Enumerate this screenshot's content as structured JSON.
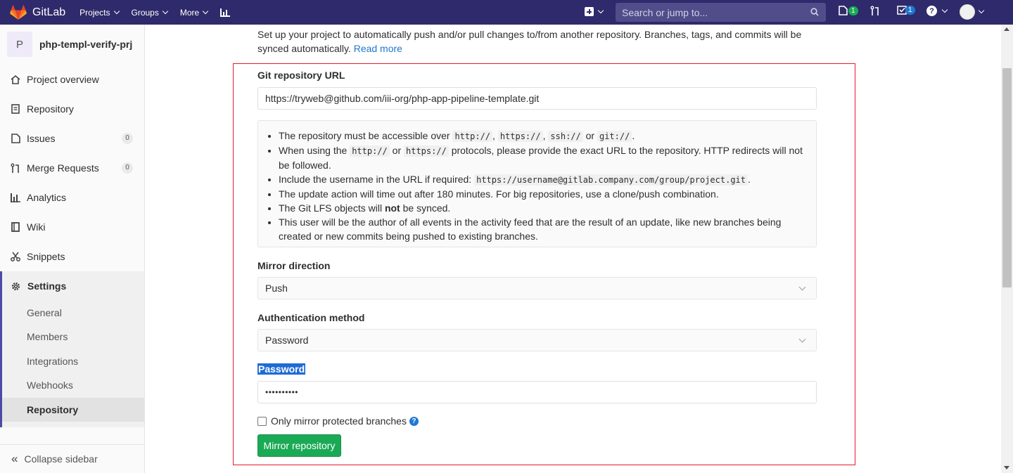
{
  "navbar": {
    "brand": "GitLab",
    "menu": [
      "Projects",
      "Groups",
      "More"
    ],
    "search_placeholder": "Search or jump to...",
    "issues_count": "1",
    "todos_count": "1"
  },
  "sidebar": {
    "project_initial": "P",
    "project_name": "php-templ-verify-prj",
    "items": [
      {
        "label": "Project overview",
        "icon": "home-icon"
      },
      {
        "label": "Repository",
        "icon": "doc-icon"
      },
      {
        "label": "Issues",
        "icon": "issues-icon",
        "count": "0"
      },
      {
        "label": "Merge Requests",
        "icon": "merge-request-icon",
        "count": "0"
      },
      {
        "label": "Analytics",
        "icon": "analytics-icon"
      },
      {
        "label": "Wiki",
        "icon": "book-icon"
      },
      {
        "label": "Snippets",
        "icon": "scissors-icon"
      }
    ],
    "settings_label": "Settings",
    "settings_sub": [
      "General",
      "Members",
      "Integrations",
      "Webhooks",
      "Repository"
    ],
    "collapse_label": "Collapse sidebar"
  },
  "main": {
    "intro_text": "Set up your project to automatically push and/or pull changes to/from another repository. Branches, tags, and commits will be synced automatically.",
    "read_more": "Read more",
    "git_url_label": "Git repository URL",
    "git_url_value": "https://tryweb@github.com/iii-org/php-app-pipeline-template.git",
    "mirror_direction_label": "Mirror direction",
    "mirror_direction_value": "Push",
    "auth_method_label": "Authentication method",
    "auth_method_value": "Password",
    "password_label": "Password",
    "password_value": "••••••••••",
    "only_protected_label": "Only mirror protected branches",
    "submit_label": "Mirror repository",
    "info": {
      "l1a": "The repository must be accessible over",
      "c_http": "http://",
      "c_https": "https://",
      "c_ssh": "ssh://",
      "or": "or",
      "c_git": "git://",
      "l2a": "When using the",
      "l2b": "protocols, please provide the exact URL to the repository. HTTP redirects will not be followed.",
      "l3a": "Include the username in the URL if required:",
      "c_example": "https://username@gitlab.company.com/group/project.git",
      "l4": "The update action will time out after 180 minutes. For big repositories, use a clone/push combination.",
      "l5a": "The Git LFS objects will",
      "l5b": "not",
      "l5c": "be synced.",
      "l6": "This user will be the author of all events in the activity feed that are the result of an update, like new branches being created or new commits being pushed to existing branches."
    }
  },
  "colors": {
    "navbar": "#2f2a6b",
    "primary_button": "#1aaa55",
    "highlight_box": "#e41c2d",
    "link": "#1f78d1"
  }
}
